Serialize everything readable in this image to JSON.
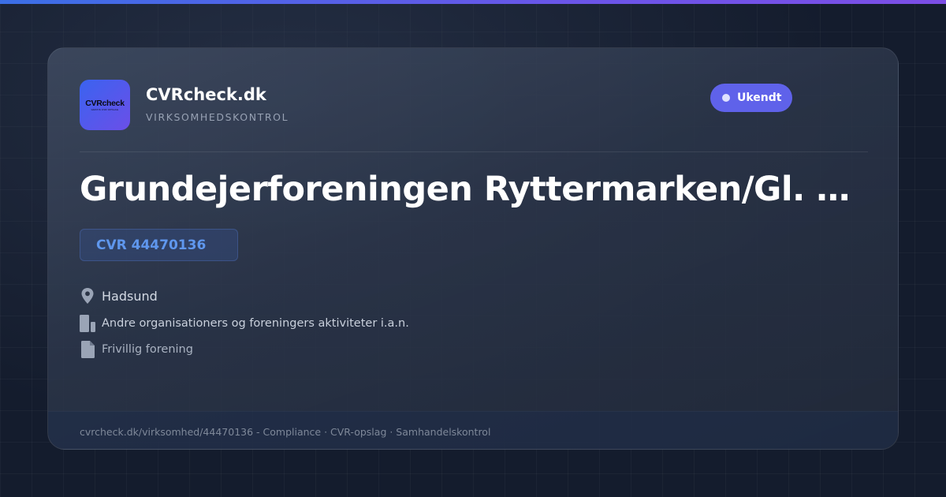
{
  "brand": {
    "logo_text": "CVRcheck",
    "logo_sub": "GRATIS CVR OPSLAG",
    "name": "CVRcheck.dk",
    "tagline": "VIRKSOMHEDSKONTROL"
  },
  "status": {
    "label": "Ukendt",
    "color": "#5f62ea"
  },
  "company": {
    "name": "Grundejerforeningen Ryttermarken/Gl. L...",
    "cvr": "CVR 44470136",
    "city": "Hadsund",
    "industry": "Andre organisationers og foreningers aktiviteter i.a.n.",
    "legal_form": "Frivillig forening"
  },
  "icons": {
    "city": "location-pin-icon",
    "industry": "building-icon",
    "legal_form": "document-icon"
  },
  "footer": {
    "text": "cvrcheck.dk/virksomhed/44470136 - Compliance · CVR-opslag · Samhandelskontrol"
  },
  "colors": {
    "accent": "#5f62ea",
    "cvr_text": "#5f97ee",
    "background": "#141c2d"
  }
}
